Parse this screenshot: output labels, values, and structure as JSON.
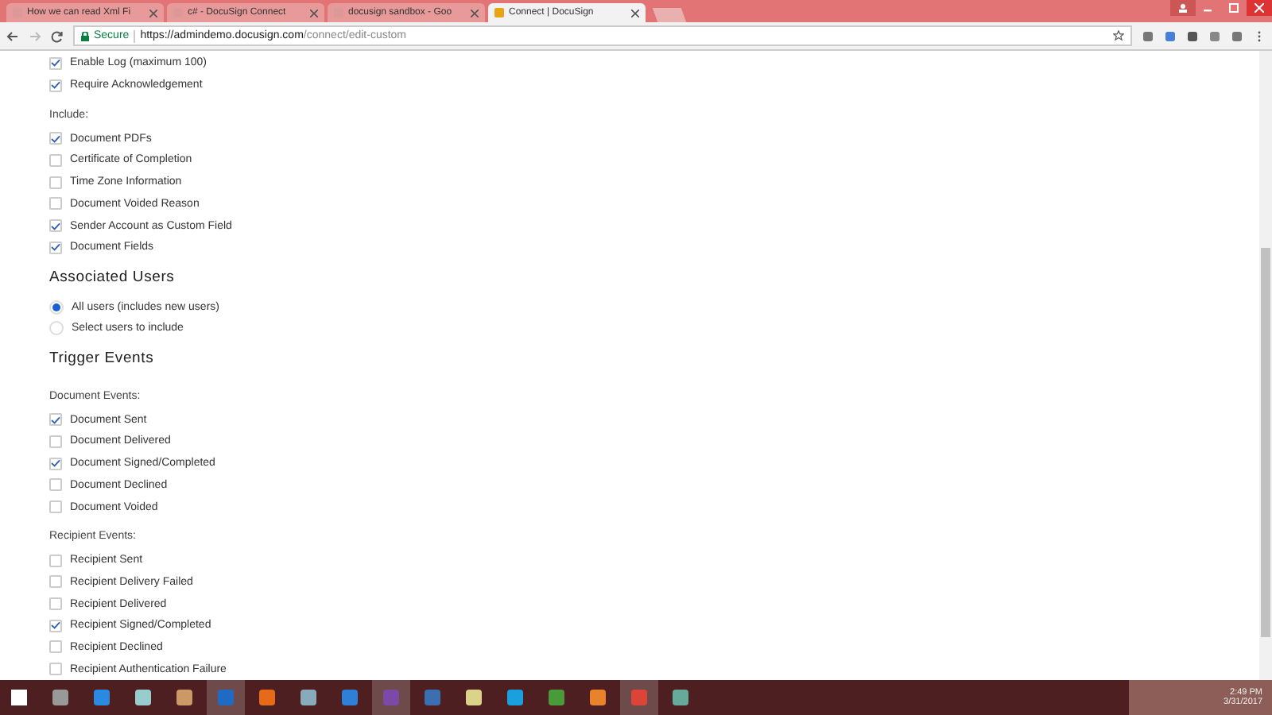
{
  "browser": {
    "tabs": [
      {
        "title": "How we can read Xml Fi",
        "selected": false
      },
      {
        "title": "c# - DocuSign Connect",
        "selected": false
      },
      {
        "title": "docusign sandbox - Goo",
        "selected": false
      },
      {
        "title": "Connect | DocuSign",
        "selected": true
      }
    ],
    "address": {
      "secure_label": "Secure",
      "url_host": "https://admindemo.docusign.com",
      "url_path": "/connect/edit-custom"
    }
  },
  "form": [
    {
      "kind": "checkbox",
      "label": "Enable Log (maximum 100)",
      "checked": true
    },
    {
      "kind": "checkbox",
      "label": "Require Acknowledgement",
      "checked": true
    },
    {
      "kind": "label",
      "label": "Include:"
    },
    {
      "kind": "checkbox",
      "label": "Document PDFs",
      "checked": true
    },
    {
      "kind": "checkbox",
      "label": "Certificate of Completion",
      "checked": false
    },
    {
      "kind": "checkbox",
      "label": "Time Zone Information",
      "checked": false
    },
    {
      "kind": "checkbox",
      "label": "Document Voided Reason",
      "checked": false
    },
    {
      "kind": "checkbox",
      "label": "Sender Account as Custom Field",
      "checked": true
    },
    {
      "kind": "checkbox",
      "label": "Document Fields",
      "checked": true
    },
    {
      "kind": "heading",
      "label": "Associated Users"
    },
    {
      "kind": "radio",
      "label": "All users (includes new users)",
      "selected": true
    },
    {
      "kind": "radio",
      "label": "Select users to include",
      "selected": false
    },
    {
      "kind": "heading",
      "label": "Trigger Events"
    },
    {
      "kind": "label",
      "label": "Document Events:"
    },
    {
      "kind": "checkbox",
      "label": "Document Sent",
      "checked": true
    },
    {
      "kind": "checkbox",
      "label": "Document Delivered",
      "checked": false
    },
    {
      "kind": "checkbox",
      "label": "Document Signed/Completed",
      "checked": true
    },
    {
      "kind": "checkbox",
      "label": "Document Declined",
      "checked": false
    },
    {
      "kind": "checkbox",
      "label": "Document Voided",
      "checked": false
    },
    {
      "kind": "label",
      "label": "Recipient Events:"
    },
    {
      "kind": "checkbox",
      "label": "Recipient Sent",
      "checked": false
    },
    {
      "kind": "checkbox",
      "label": "Recipient Delivery Failed",
      "checked": false
    },
    {
      "kind": "checkbox",
      "label": "Recipient Delivered",
      "checked": false
    },
    {
      "kind": "checkbox",
      "label": "Recipient Signed/Completed",
      "checked": true
    },
    {
      "kind": "checkbox",
      "label": "Recipient Declined",
      "checked": false
    },
    {
      "kind": "checkbox",
      "label": "Recipient Authentication Failure",
      "checked": false
    }
  ],
  "taskbar": {
    "time": "2:49 PM",
    "date": "3/31/2017"
  }
}
